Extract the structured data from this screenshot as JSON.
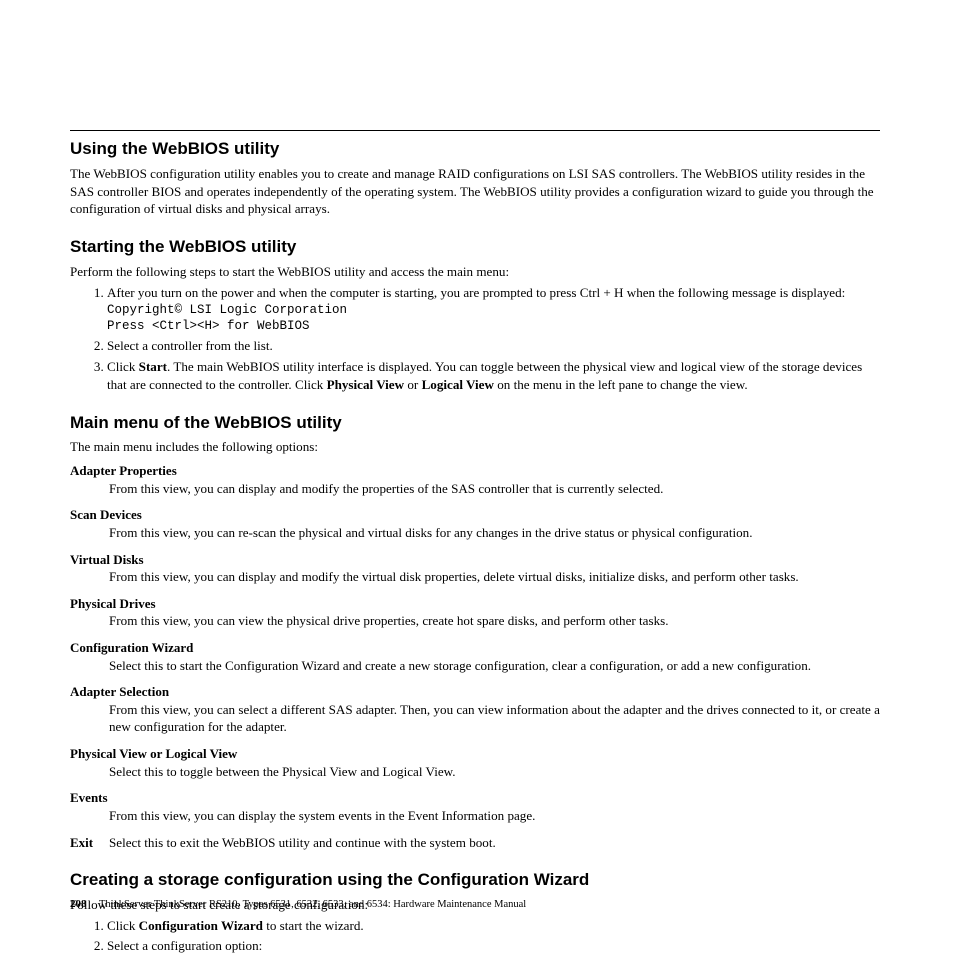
{
  "sections": {
    "s1": {
      "heading": "Using the WebBIOS utility",
      "p1": "The WebBIOS configuration utility enables you to create and manage RAID configurations on LSI SAS controllers. The WebBIOS utility resides in the SAS controller BIOS and operates independently of the operating system. The WebBIOS utility provides a configuration wizard to guide you through the configuration of virtual disks and physical arrays."
    },
    "s2": {
      "heading": "Starting the WebBIOS utility",
      "intro": "Perform the following steps to start the WebBIOS utility and access the main menu:",
      "step1": "After you turn on the power and when the computer is starting, you are prompted to press Ctrl + H when the following message is displayed:",
      "code": "Copyright© LSI Logic Corporation\nPress <Ctrl><H> for WebBIOS",
      "step2": "Select a controller from the list.",
      "step3a": "Click ",
      "step3_start": "Start",
      "step3b": ". The main WebBIOS utility interface is displayed. You can toggle between the physical view and logical view of the storage devices that are connected to the controller. Click ",
      "step3_pv": "Physical View",
      "step3c": " or ",
      "step3_lv": "Logical View",
      "step3d": " on the menu in the left pane to change the view."
    },
    "s3": {
      "heading": "Main menu of the WebBIOS utility",
      "intro": "The main menu includes the following options:",
      "items": {
        "adapter_properties": {
          "t": "Adapter Properties",
          "d": "From this view, you can display and modify the properties of the SAS controller that is currently selected."
        },
        "scan_devices": {
          "t": "Scan Devices",
          "d": "From this view, you can re-scan the physical and virtual disks for any changes in the drive status or physical configuration."
        },
        "virtual_disks": {
          "t": "Virtual Disks",
          "d": "From this view, you can display and modify the virtual disk properties, delete virtual disks, initialize disks, and perform other tasks."
        },
        "physical_drives": {
          "t": "Physical Drives",
          "d": "From this view, you can view the physical drive properties, create hot spare disks, and perform other tasks."
        },
        "config_wizard": {
          "t": "Configuration Wizard",
          "d": "Select this to start the Configuration Wizard and create a new storage configuration, clear a configuration, or add a new configuration."
        },
        "adapter_selection": {
          "t": "Adapter Selection",
          "d": "From this view, you can select a different SAS adapter. Then, you can view information about the adapter and the drives connected to it, or create a new configuration for the adapter."
        },
        "view_toggle": {
          "t": "Physical View or Logical View",
          "d": "Select this to toggle between the Physical View and Logical View."
        },
        "events": {
          "t": "Events",
          "d": "From this view, you can display the system events in the Event Information page."
        },
        "exit": {
          "t": "Exit",
          "d": "Select this to exit the WebBIOS utility and continue with the system boot."
        }
      }
    },
    "s4": {
      "heading": "Creating a storage configuration using the Configuration Wizard",
      "intro": "Follow these steps to start create a storage configuration:",
      "step1a": "Click ",
      "step1b": "Configuration Wizard",
      "step1c": " to start the wizard.",
      "step2": "Select a configuration option:"
    }
  },
  "footer": {
    "page": "208",
    "text": "ThinkServer ThinkServer RS210, Types 6531, 6532, 6533, and 6534: Hardware Maintenance Manual"
  }
}
